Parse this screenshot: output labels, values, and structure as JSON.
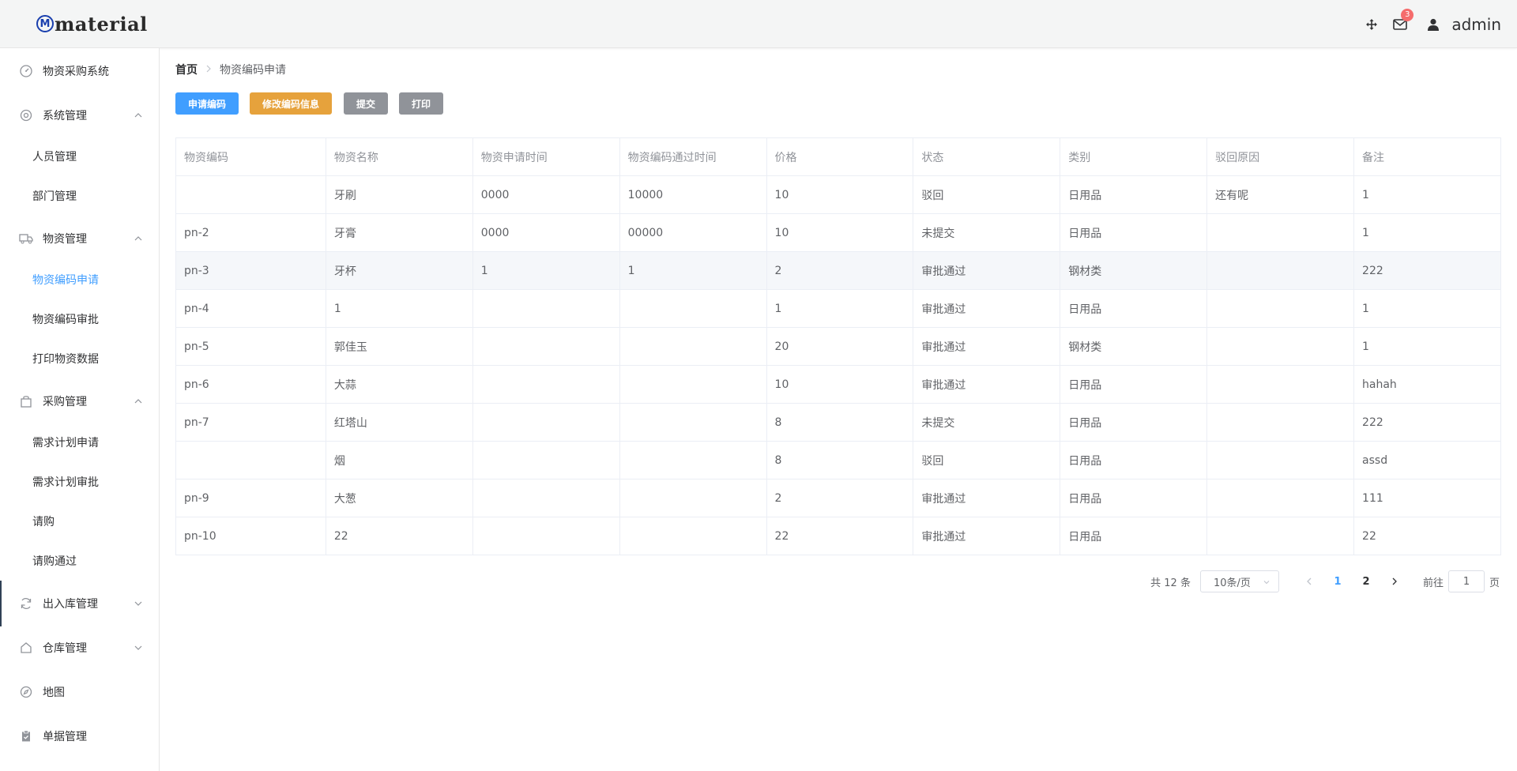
{
  "header": {
    "logo_text": "material",
    "logo_mark": "M",
    "notification_count": "3",
    "username": "admin",
    "icons": [
      "move-icon",
      "mail-icon",
      "user-icon"
    ]
  },
  "sidebar": {
    "items": [
      {
        "label": "物资采购系统",
        "icon": "dashboard-icon"
      },
      {
        "label": "系统管理",
        "icon": "settings-icon",
        "expanded": true,
        "children": [
          "人员管理",
          "部门管理"
        ]
      },
      {
        "label": "物资管理",
        "icon": "truck-icon",
        "expanded": true,
        "children": [
          "物资编码申请",
          "物资编码审批",
          "打印物资数据"
        ]
      },
      {
        "label": "采购管理",
        "icon": "shopping-bag-icon",
        "expanded": true,
        "children": [
          "需求计划申请",
          "需求计划审批",
          "请购",
          "请购通过"
        ]
      },
      {
        "label": "出入库管理",
        "icon": "refresh-icon",
        "expanded": false
      },
      {
        "label": "仓库管理",
        "icon": "house-icon",
        "expanded": false
      },
      {
        "label": "地图",
        "icon": "compass-icon"
      },
      {
        "label": "单据管理",
        "icon": "clipboard-icon"
      }
    ],
    "active": "物资编码申请",
    "active_color": "#409eff"
  },
  "breadcrumb": {
    "home": "首页",
    "current": "物资编码申请"
  },
  "toolbar": {
    "apply_label": "申请编码",
    "edit_label": "修改编码信息",
    "submit_label": "提交",
    "print_label": "打印",
    "colors": {
      "primary": "#409eff",
      "warning": "#e6a23c",
      "info": "#909399"
    }
  },
  "table": {
    "columns": [
      "物资编码",
      "物资名称",
      "物资申请时间",
      "物资编码通过时间",
      "价格",
      "状态",
      "类别",
      "驳回原因",
      "备注"
    ],
    "rows": [
      [
        "",
        "牙刷",
        "0000",
        "10000",
        "10",
        "驳回",
        "日用品",
        "还有呢",
        "1"
      ],
      [
        "pn-2",
        "牙膏",
        "0000",
        "00000",
        "10",
        "未提交",
        "日用品",
        "",
        "1"
      ],
      [
        "pn-3",
        "牙杯",
        "1",
        "1",
        "2",
        "审批通过",
        "钢材类",
        "",
        "222"
      ],
      [
        "pn-4",
        "1",
        "",
        "",
        "1",
        "审批通过",
        "日用品",
        "",
        "1"
      ],
      [
        "pn-5",
        "郭佳玉",
        "",
        "",
        "20",
        "审批通过",
        "钢材类",
        "",
        "1"
      ],
      [
        "pn-6",
        "大蒜",
        "",
        "",
        "10",
        "审批通过",
        "日用品",
        "",
        "hahah"
      ],
      [
        "pn-7",
        "红塔山",
        "",
        "",
        "8",
        "未提交",
        "日用品",
        "",
        "222"
      ],
      [
        "",
        "烟",
        "",
        "",
        "8",
        "驳回",
        "日用品",
        "",
        "assd"
      ],
      [
        "pn-9",
        "大葱",
        "",
        "",
        "2",
        "审批通过",
        "日用品",
        "",
        "111"
      ],
      [
        "pn-10",
        "22",
        "",
        "",
        "22",
        "审批通过",
        "日用品",
        "",
        "22"
      ]
    ],
    "highlighted_row": 2
  },
  "pagination": {
    "total_label": "共 12 条",
    "page_size": "10条/页",
    "pages": [
      "1",
      "2"
    ],
    "current_page": "1",
    "goto_label": "前往",
    "goto_value": "1",
    "page_suffix": "页"
  }
}
